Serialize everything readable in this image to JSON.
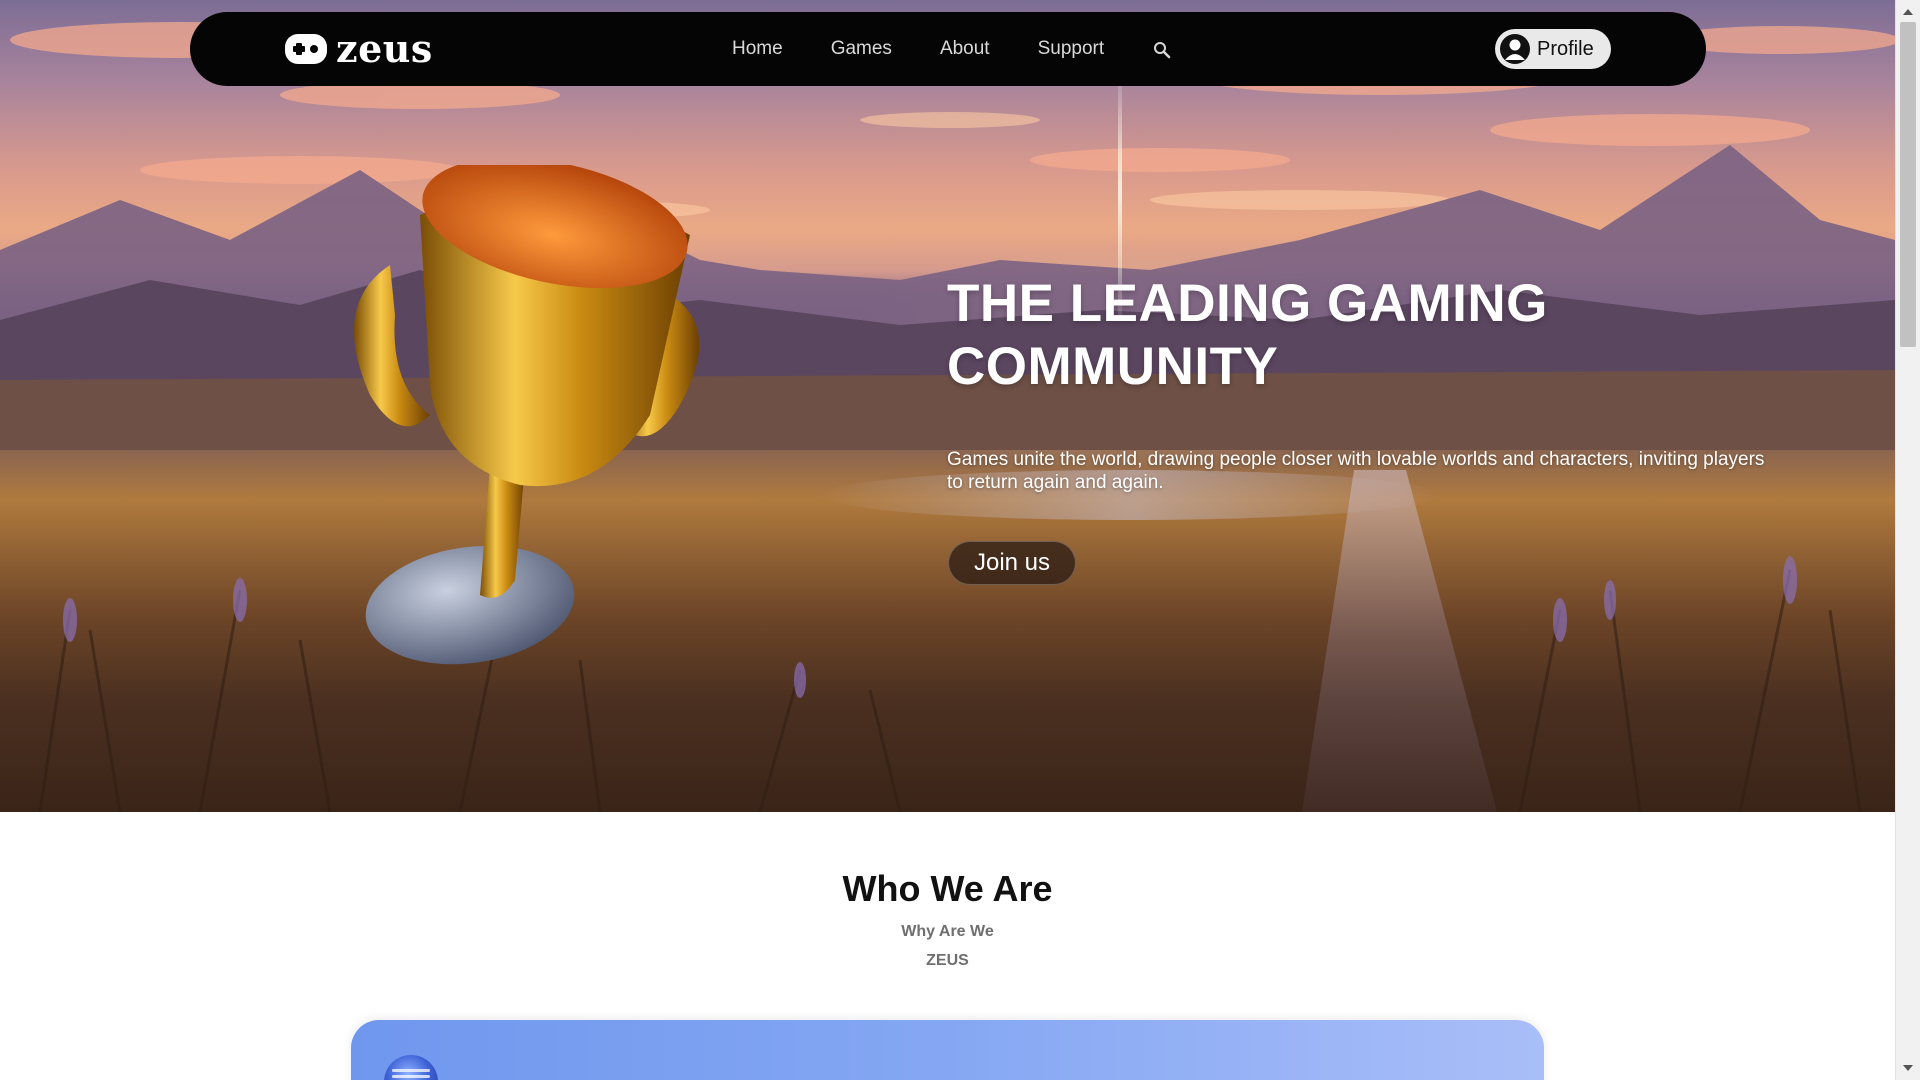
{
  "nav": {
    "brand": "zeus",
    "links": [
      "Home",
      "Games",
      "About",
      "Support"
    ],
    "profile_label": "Profile"
  },
  "hero": {
    "title": "THE LEADING GAMING COMMUNITY",
    "subtitle": "Games unite the world, drawing people closer with lovable worlds and characters, inviting players to return again and again.",
    "cta_label": "Join us"
  },
  "about": {
    "title": "Who We Are",
    "subtitle_line1": "Why Are We",
    "subtitle_line2": "ZEUS"
  },
  "colors": {
    "navbar": "#050505",
    "card_gradient_start": "#6f97ee",
    "card_gradient_end": "#a9bef8"
  },
  "icons": [
    "gamepad-logo-icon",
    "search-icon",
    "user-avatar-icon",
    "trophy-image",
    "scroll-up-icon",
    "scroll-down-icon"
  ]
}
